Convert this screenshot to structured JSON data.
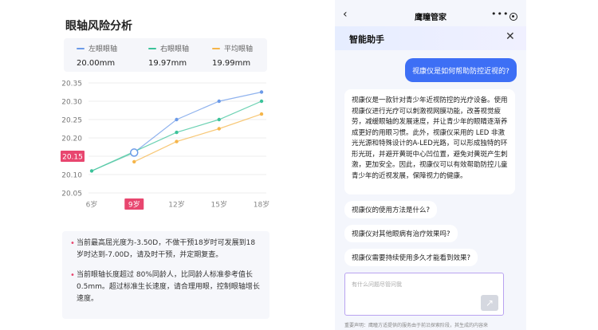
{
  "left": {
    "title": "眼轴风险分析",
    "legend": [
      {
        "label": "左眼眼轴",
        "value": "20.00mm",
        "color": "#6b9ae8"
      },
      {
        "label": "右眼眼轴",
        "value": "19.97mm",
        "color": "#3cc39a"
      },
      {
        "label": "平均眼轴",
        "value": "19.99mm",
        "color": "#f5b54a"
      }
    ],
    "notes": [
      "当前最高屈光度为-3.50D，不做干预18岁时可发展到18岁时达到-7.00D，请及时干预，并定期复查。",
      "当前眼轴长度超过 80%同龄人，比同龄人标准参考值长0.5mm。超过标准生长速度，请合理用眼，控制眼轴增长速度。"
    ]
  },
  "chart_data": {
    "type": "line",
    "categories": [
      "6岁",
      "9岁",
      "12岁",
      "15岁",
      "18岁"
    ],
    "x": [
      6,
      7.5,
      9,
      10.5,
      12,
      13.5,
      15,
      16.5,
      18
    ],
    "series": [
      {
        "name": "左眼眼轴",
        "color": "#6b9ae8",
        "values": [
          null,
          null,
          20.16,
          null,
          20.25,
          null,
          20.3,
          null,
          20.325
        ]
      },
      {
        "name": "右眼眼轴",
        "color": "#3cc39a",
        "values": [
          20.11,
          null,
          null,
          null,
          20.215,
          null,
          20.25,
          null,
          20.3
        ]
      },
      {
        "name": "平均眼轴",
        "color": "#f5b54a",
        "values": [
          null,
          null,
          20.135,
          null,
          20.19,
          null,
          20.225,
          null,
          20.265
        ]
      }
    ],
    "connector": [
      [
        6,
        20.11
      ],
      [
        9,
        20.16
      ]
    ],
    "yticks": [
      "20.35",
      "20.30",
      "20.25",
      "20.20",
      "20.15",
      "20.10",
      "20.05"
    ],
    "ylim": [
      20.05,
      20.35
    ],
    "highlight_x": "9岁",
    "highlight_y": "20.15",
    "grid": true,
    "legend": "top"
  },
  "phone": {
    "back": "‹",
    "app_title": "鹰瞳管家",
    "more": "•••",
    "assistant_title": "智能助手",
    "close": "✕",
    "user_message": "视康仪是如何帮助防控近视的?",
    "bot_message": "视康仪是一款针对青少年近视防控的光疗设备。使用视康仪进行光疗可以刺激视网膜功能，改善视觉疲劳，减缓眼轴的发展速度，并让青少年的眼睛逐渐养成更好的用眼习惯。此外，视康仪采用的 LED 非激光光源和特殊设计的A-LED光路，可以形成独特的环形光斑，并避开黄斑中心凹位置，避免对黄斑产生刺激，更加安全。因此，视康仪可以有效帮助防控儿童青少年的近视发展，保障视力的健康。",
    "suggestions": [
      "视康仪的使用方法是什么?",
      "视康仪对其他眼病有治疗效果吗?",
      "视康仪需要持续使用多久才能看到效果?"
    ],
    "input_placeholder": "有什么问题尽管问我",
    "send_icon": "↗",
    "disclaimer": "重要声明：鹰瞳方适提供的服务由于前沿探索阶段，其生成的内容来"
  }
}
